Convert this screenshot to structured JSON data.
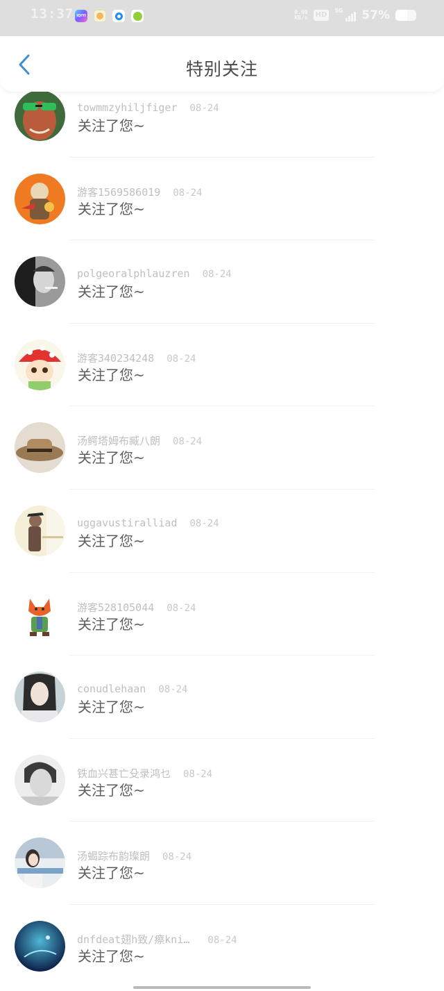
{
  "status_bar": {
    "time": "13:37",
    "app_icons": [
      "iqiyi-icon",
      "baby-app-icon",
      "browser-icon",
      "fruit-app-icon"
    ],
    "iqiyi_label": "iQIYI",
    "net_speed_value": "0.00",
    "net_speed_unit": "KB/s",
    "hd": "HD",
    "network": "5G",
    "battery_pct": "57%",
    "battery_level": 0.57
  },
  "nav": {
    "title": "特别关注"
  },
  "list": {
    "items": [
      {
        "name": "towmmzyhiljfiger",
        "date": "08-24",
        "action": "关注了您~"
      },
      {
        "name": "游客1569586019",
        "date": "08-24",
        "action": "关注了您~"
      },
      {
        "name": "polgeoralphlauzren",
        "date": "08-24",
        "action": "关注了您~"
      },
      {
        "name": "游客340234248",
        "date": "08-24",
        "action": "关注了您~"
      },
      {
        "name": "汤鳄塔姆布臧八朗",
        "date": "08-24",
        "action": "关注了您~"
      },
      {
        "name": "uggavustiralliad",
        "date": "08-24",
        "action": "关注了您~"
      },
      {
        "name": "游客528105044",
        "date": "08-24",
        "action": "关注了您~"
      },
      {
        "name": "conudlehaan",
        "date": "08-24",
        "action": "关注了您~"
      },
      {
        "name": "铁血兴甚亡殳录鸿乜",
        "date": "08-24",
        "action": "关注了您~"
      },
      {
        "name": "汤蝎踪布韵璨朗",
        "date": "08-24",
        "action": "关注了您~"
      },
      {
        "name": "dnfdeat翅h致/瘵kni…",
        "date": "08-24",
        "action": "关注了您~"
      }
    ]
  },
  "colors": {
    "status_bar_bg": "#dedede",
    "back_arrow": "#3a8fd8",
    "title": "#4a4a4a",
    "username": "#bfbfbf",
    "action": "#5e5e5e"
  }
}
